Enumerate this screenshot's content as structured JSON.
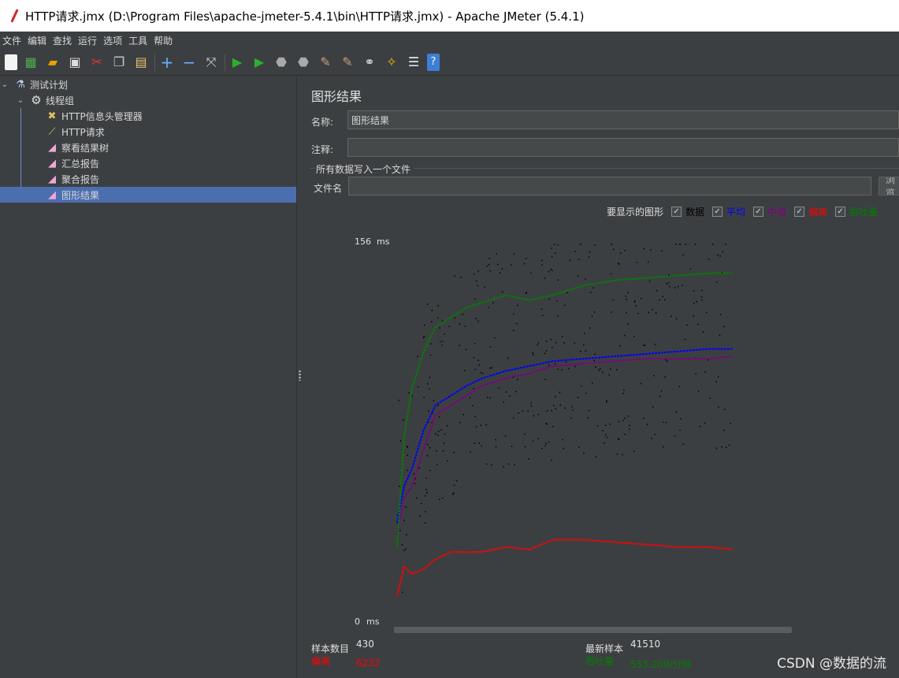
{
  "window": {
    "title": "HTTP请求.jmx (D:\\Program Files\\apache-jmeter-5.4.1\\bin\\HTTP请求.jmx) - Apache JMeter (5.4.1)"
  },
  "menu": [
    "文件",
    "编辑",
    "查找",
    "运行",
    "选项",
    "工具",
    "帮助"
  ],
  "toolbar": {
    "icons": [
      "new-icon",
      "templates-icon",
      "open-icon",
      "save-icon",
      "cut-icon",
      "copy-icon",
      "paste-icon",
      "expand-icon",
      "collapse-icon",
      "toggle-icon",
      "start-icon",
      "start-no-pause-icon",
      "stop-icon",
      "shutdown-icon",
      "clear-icon",
      "clear-all-icon",
      "search-icon",
      "reset-search-icon",
      "function-helper-icon",
      "help-icon"
    ]
  },
  "tree": {
    "items": [
      {
        "label": "测试计划",
        "icon": "flask-icon",
        "level": 0
      },
      {
        "label": "线程组",
        "icon": "gear-icon",
        "level": 1
      },
      {
        "label": "HTTP信息头管理器",
        "icon": "tools-icon",
        "level": 2
      },
      {
        "label": "HTTP请求",
        "icon": "pipette-icon",
        "level": 2
      },
      {
        "label": "察看结果树",
        "icon": "graph-icon",
        "level": 2
      },
      {
        "label": "汇总报告",
        "icon": "graph-icon",
        "level": 2
      },
      {
        "label": "聚合报告",
        "icon": "graph-icon",
        "level": 2
      },
      {
        "label": "图形结果",
        "icon": "graph-icon",
        "level": 2,
        "selected": true
      }
    ]
  },
  "panel": {
    "title": "图形结果",
    "name_label": "名称:",
    "name_value": "图形结果",
    "comment_label": "注释:",
    "comment_value": "",
    "file_group": "所有数据写入一个文件",
    "filename_label": "文件名",
    "filename_value": "",
    "browse_label": "浏览...",
    "legend_label": "要显示的图形",
    "legend_items": [
      {
        "label": "数据",
        "color": "#000000",
        "checked": true
      },
      {
        "label": "平均",
        "color": "#0000ff",
        "checked": true
      },
      {
        "label": "中值",
        "color": "#800080",
        "checked": true
      },
      {
        "label": "偏离",
        "color": "#ff0000",
        "checked": true
      },
      {
        "label": "吞吐量",
        "color": "#008000",
        "checked": true
      }
    ]
  },
  "chart_data": {
    "type": "line",
    "ylabel_top": "156",
    "ylabel_bottom": "0",
    "y_unit": "ms",
    "ylim": [
      0,
      156
    ],
    "x": [
      1,
      10,
      20,
      35,
      50,
      70,
      90,
      110,
      140,
      170,
      200,
      240,
      280,
      320,
      360,
      400,
      430
    ],
    "series": [
      {
        "name": "平均",
        "color": "#0000ff",
        "values": [
          40,
          55,
          62,
          78,
          88,
          92,
          96,
          99,
          102,
          104,
          106,
          107,
          108,
          109,
          110,
          111,
          111
        ]
      },
      {
        "name": "中值",
        "color": "#800080",
        "values": [
          35,
          50,
          55,
          70,
          84,
          88,
          92,
          96,
          99,
          101,
          104,
          105,
          106,
          107,
          107,
          107,
          108
        ]
      },
      {
        "name": "偏离",
        "color": "#ff0000",
        "values": [
          10,
          22,
          19,
          21,
          25,
          28,
          28,
          28,
          30,
          29,
          33,
          33,
          32,
          31,
          30,
          30,
          29
        ]
      },
      {
        "name": "吞吐量",
        "color": "#008000",
        "values": [
          30,
          75,
          95,
          110,
          120,
          124,
          128,
          130,
          133,
          131,
          133,
          137,
          139,
          140,
          141,
          142,
          142
        ]
      }
    ],
    "scatter_color": "#000000"
  },
  "stats": {
    "samples_label": "样本数目",
    "samples_value": "430",
    "deviation_label": "偏离",
    "deviation_value": "6232",
    "latest_label": "最新样本",
    "latest_value": "41510",
    "throughput_label": "吞吐量",
    "throughput_value": "553.209/分钟"
  },
  "watermark": "CSDN @数据的流"
}
